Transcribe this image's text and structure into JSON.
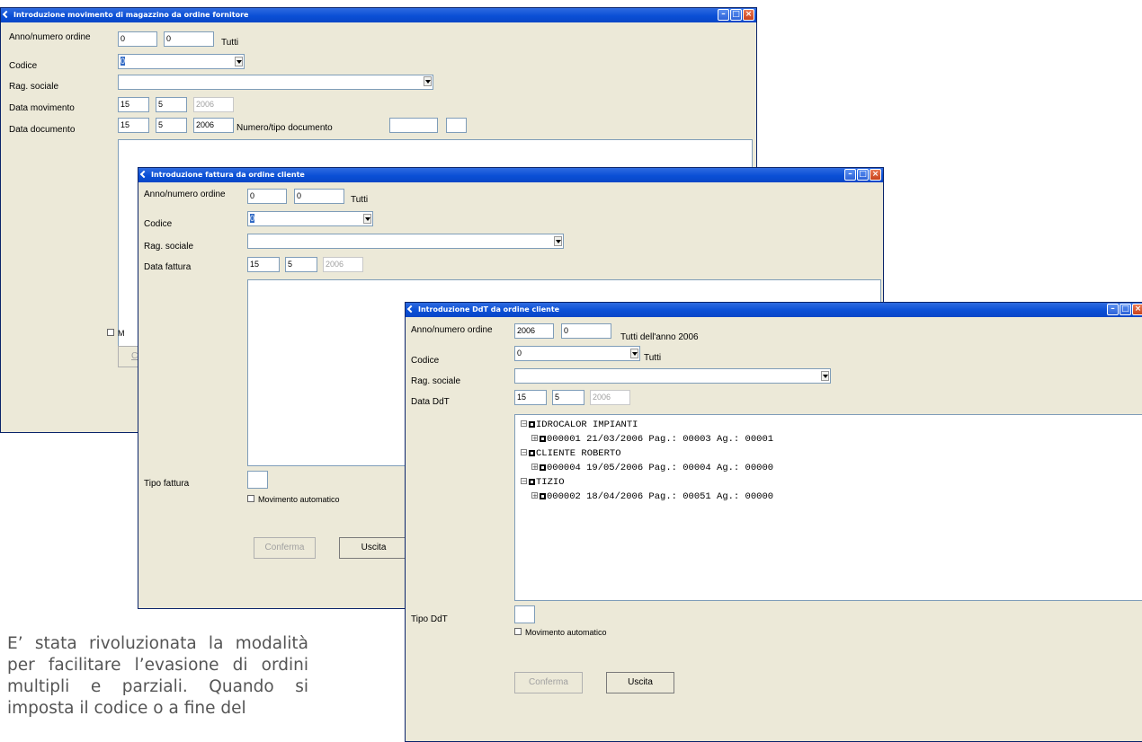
{
  "window1": {
    "title": "Introduzione movimento di magazzino da ordine fornitore",
    "labels": {
      "anno_numero": "Anno/numero ordine",
      "codice": "Codice",
      "rag_sociale": "Rag. sociale",
      "data_movimento": "Data movimento",
      "data_documento": "Data documento",
      "numero_tipo": "Numero/tipo documento"
    },
    "anno": "0",
    "numero": "0",
    "tutti": "Tutti",
    "codice_value": "0",
    "rag_sociale_value": "",
    "data_movimento": {
      "day": "15",
      "month": "5",
      "year": "2006"
    },
    "data_documento": {
      "day": "15",
      "month": "5",
      "year": "2006"
    },
    "checkbox_partial": "M",
    "button_partial": "C"
  },
  "window2": {
    "title": "Introduzione fattura da ordine cliente",
    "labels": {
      "anno_numero": "Anno/numero ordine",
      "codice": "Codice",
      "rag_sociale": "Rag. sociale",
      "data_fattura": "Data fattura",
      "tipo_fattura": "Tipo fattura"
    },
    "anno": "0",
    "numero": "0",
    "tutti": "Tutti",
    "codice_value": "0",
    "data_fattura": {
      "day": "15",
      "month": "5",
      "year": "2006"
    },
    "movimento_automatico": "Movimento automatico",
    "conferma": "Conferma",
    "uscita": "Uscita"
  },
  "window3": {
    "title": "Introduzione DdT da ordine cliente",
    "labels": {
      "anno_numero": "Anno/numero ordine",
      "codice": "Codice",
      "rag_sociale": "Rag. sociale",
      "data_ddt": "Data DdT",
      "tipo_ddt": "Tipo DdT"
    },
    "anno": "2006",
    "numero": "0",
    "tutti_anno": "Tutti dell'anno 2006",
    "codice_value": "0",
    "tutti": "Tutti",
    "data_ddt": {
      "day": "15",
      "month": "5",
      "year": "2006"
    },
    "tree": [
      {
        "customer": "IDROCALOR IMPIANTI",
        "order": "000001 21/03/2006 Pag.: 00003 Ag.: 00001"
      },
      {
        "customer": "CLIENTE ROBERTO",
        "order": "000004 19/05/2006 Pag.: 00004 Ag.: 00000"
      },
      {
        "customer": "TIZIO",
        "order": "000002 18/04/2006 Pag.: 00051 Ag.: 00000"
      }
    ],
    "movimento_automatico": "Movimento automatico",
    "conferma": "Conferma",
    "uscita": "Uscita"
  },
  "body_text": "E’ stata rivoluzionata la modalità per facilitare l’evasione di ordini multipli e parziali. Quando si imposta il codice o a fine del"
}
